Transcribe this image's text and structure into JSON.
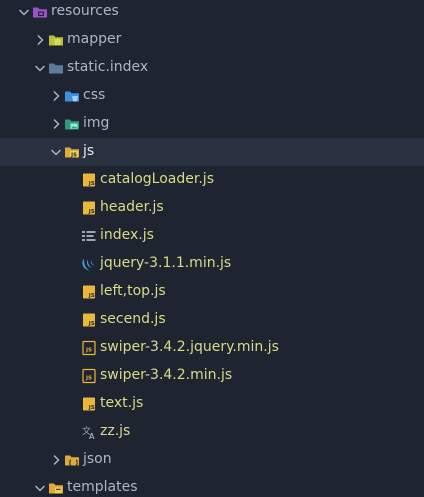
{
  "tree": {
    "rows": [
      {
        "name": "folder-resources",
        "label": "resources",
        "kind": "folder",
        "chevron": "expanded",
        "icon": "folder-resources-icon",
        "depth": 0
      },
      {
        "name": "folder-mapper",
        "label": "mapper",
        "kind": "folder",
        "chevron": "collapsed",
        "icon": "folder-mapper-icon",
        "depth": 1
      },
      {
        "name": "folder-static-index",
        "label": "static.index",
        "kind": "folder",
        "chevron": "expanded",
        "icon": "folder-icon",
        "depth": 1
      },
      {
        "name": "folder-css",
        "label": "css",
        "kind": "folder",
        "chevron": "collapsed",
        "icon": "folder-css-icon",
        "depth": 2
      },
      {
        "name": "folder-img",
        "label": "img",
        "kind": "folder",
        "chevron": "collapsed",
        "icon": "folder-images-icon",
        "depth": 2
      },
      {
        "name": "folder-js",
        "label": "js",
        "kind": "folder",
        "chevron": "expanded",
        "icon": "folder-js-icon",
        "depth": 2,
        "selected": true
      },
      {
        "name": "file-catalogloader-js",
        "label": "catalogLoader.js",
        "kind": "file",
        "icon": "js-file-icon",
        "depth": 3
      },
      {
        "name": "file-header-js",
        "label": "header.js",
        "kind": "file",
        "icon": "js-file-icon",
        "depth": 3
      },
      {
        "name": "file-index-js",
        "label": "index.js",
        "kind": "file",
        "icon": "list-file-icon",
        "depth": 3
      },
      {
        "name": "file-jquery-js",
        "label": "jquery-3.1.1.min.js",
        "kind": "file",
        "icon": "jquery-icon",
        "depth": 3
      },
      {
        "name": "file-left-top-js",
        "label": "left,top.js",
        "kind": "file",
        "icon": "js-file-icon",
        "depth": 3
      },
      {
        "name": "file-secend-js",
        "label": "secend.js",
        "kind": "file",
        "icon": "js-file-icon",
        "depth": 3
      },
      {
        "name": "file-swiper-jquery-js",
        "label": "swiper-3.4.2.jquery.min.js",
        "kind": "file",
        "icon": "js-min-icon",
        "depth": 3
      },
      {
        "name": "file-swiper-min-js",
        "label": "swiper-3.4.2.min.js",
        "kind": "file",
        "icon": "js-min-icon",
        "depth": 3
      },
      {
        "name": "file-text-js",
        "label": "text.js",
        "kind": "file",
        "icon": "js-file-icon",
        "depth": 3
      },
      {
        "name": "file-zz-js",
        "label": "zz.js",
        "kind": "file",
        "icon": "translate-icon",
        "depth": 3
      },
      {
        "name": "folder-json",
        "label": "json",
        "kind": "folder",
        "chevron": "collapsed",
        "icon": "folder-json-icon",
        "depth": 2
      },
      {
        "name": "folder-templates",
        "label": "templates",
        "kind": "folder",
        "chevron": "expanded",
        "icon": "folder-templates-icon",
        "depth": 1
      }
    ]
  },
  "colors": {
    "background": "#1e2430",
    "selected_row": "#2a3140",
    "folder_text": "#aeb7c4",
    "file_text": "#d8dc8a",
    "chevron": "#aab2bf",
    "js_yellow": "#e8b83a",
    "folder_yellow": "#e0a93b",
    "folder_purple": "#9b52c8",
    "folder_olive": "#b7c23a",
    "folder_blue_gray": "#5e7a99",
    "folder_css_blue": "#3d8fe0",
    "folder_img_teal": "#2f9a84",
    "jquery_blue": "#4aa3e0"
  }
}
